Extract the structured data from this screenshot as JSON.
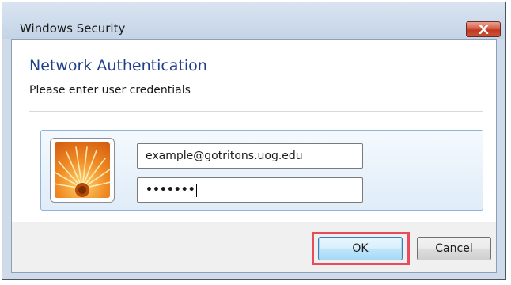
{
  "window": {
    "title": "Windows Security"
  },
  "dialog": {
    "heading": "Network Authentication",
    "subheading": "Please enter user credentials"
  },
  "credentials": {
    "username": "example@gotritons.uog.edu",
    "password_masked": "•••••••"
  },
  "buttons": {
    "ok_label": "OK",
    "cancel_label": "Cancel"
  },
  "colors": {
    "heading": "#1e3f8a",
    "highlight": "#e84b5b",
    "close_button": "#c9543c"
  },
  "icons": {
    "close": "close-icon",
    "avatar": "user-tile-flower"
  }
}
